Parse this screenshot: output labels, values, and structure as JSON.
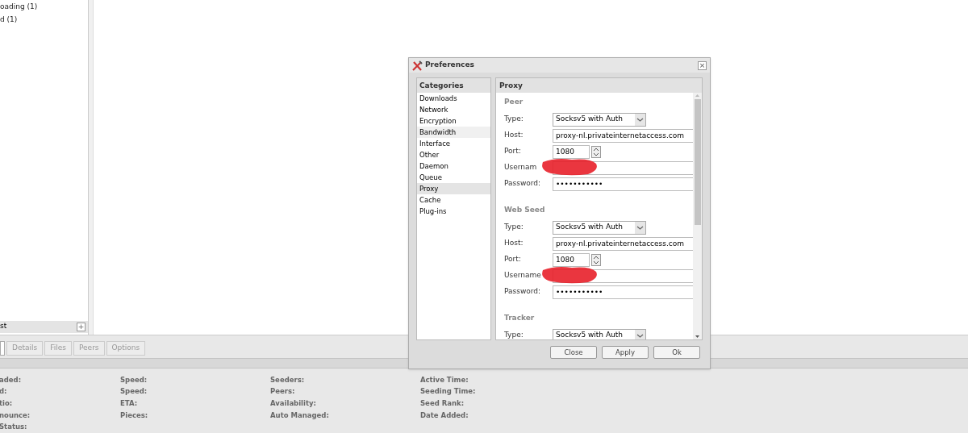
{
  "sidebar": {
    "items": [
      {
        "label": "oading (1)"
      },
      {
        "label": "d (1)"
      }
    ],
    "footer_label": "st",
    "add_button": "+"
  },
  "bottom_tabs": [
    {
      "selected": true
    },
    {
      "label": "Details",
      "selected": false
    },
    {
      "label": "Files",
      "selected": false
    },
    {
      "label": "Peers",
      "selected": false
    },
    {
      "label": "Options",
      "selected": false
    }
  ],
  "details_columns": [
    [
      "aded:",
      "d:",
      "tio:",
      "nounce:",
      "Status:"
    ],
    [
      "Speed:",
      "Speed:",
      "ETA:",
      "Pieces:"
    ],
    [
      "Seeders:",
      "Peers:",
      "Availability:",
      "Auto Managed:"
    ],
    [
      "Active Time:",
      "Seeding Time:",
      "Seed Rank:",
      "Date Added:"
    ]
  ],
  "dialog": {
    "title": "Preferences",
    "close": "×",
    "categories": {
      "heading": "Categories",
      "items": [
        {
          "label": "Downloads",
          "selected": false,
          "hovered": false
        },
        {
          "label": "Network",
          "selected": false,
          "hovered": false
        },
        {
          "label": "Encryption",
          "selected": false,
          "hovered": false
        },
        {
          "label": "Bandwidth",
          "selected": false,
          "hovered": true
        },
        {
          "label": "Interface",
          "selected": false,
          "hovered": false
        },
        {
          "label": "Other",
          "selected": false,
          "hovered": false
        },
        {
          "label": "Daemon",
          "selected": false,
          "hovered": false
        },
        {
          "label": "Queue",
          "selected": false,
          "hovered": false
        },
        {
          "label": "Proxy",
          "selected": true,
          "hovered": false
        },
        {
          "label": "Cache",
          "selected": false,
          "hovered": false
        },
        {
          "label": "Plug-ins",
          "selected": false,
          "hovered": false
        }
      ]
    },
    "panel_heading": "Proxy",
    "sections": [
      {
        "title": "Peer",
        "fields": [
          {
            "kind": "select",
            "label": "Type:",
            "value": "Socksv5 with Auth"
          },
          {
            "kind": "text",
            "label": "Host:",
            "value": "proxy-nl.privateinternetaccess.com"
          },
          {
            "kind": "spin",
            "label": "Port:",
            "value": "1080"
          },
          {
            "kind": "redacted",
            "label": "Usernam"
          },
          {
            "kind": "text",
            "label": "Password:",
            "value": "•••••••••••"
          }
        ]
      },
      {
        "title": "Web Seed",
        "fields": [
          {
            "kind": "select",
            "label": "Type:",
            "value": "Socksv5 with Auth"
          },
          {
            "kind": "text",
            "label": "Host:",
            "value": "proxy-nl.privateinternetaccess.com"
          },
          {
            "kind": "spin",
            "label": "Port:",
            "value": "1080"
          },
          {
            "kind": "redacted",
            "label": "Username"
          },
          {
            "kind": "text",
            "label": "Password:",
            "value": "•••••••••••"
          }
        ]
      },
      {
        "title": "Tracker",
        "fields": [
          {
            "kind": "select",
            "label": "Type:",
            "value": "Socksv5 with Auth"
          }
        ]
      }
    ],
    "buttons": [
      "Close",
      "Apply",
      "Ok"
    ]
  }
}
